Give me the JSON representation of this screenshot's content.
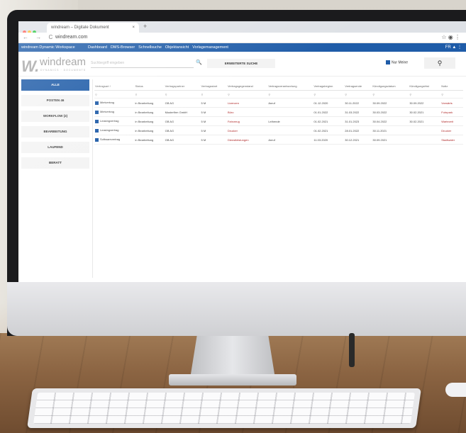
{
  "browser": {
    "tab_title": "windream – Digitale Dokument",
    "tab_close": "×",
    "new_tab": "+",
    "nav": "← → C",
    "url": "windream.com",
    "right_icons": "☆ ◉ ⋮",
    "dot_colors": [
      "#ff5f57",
      "#febc2e",
      "#28c840"
    ]
  },
  "appbar": {
    "brand": "windream Dynamic Workspace",
    "links": [
      "Dashboard",
      "DMS-Browser",
      "Schnellsuche",
      "Objekt­ansicht",
      "Vorlagemanagement"
    ],
    "right": "FR ▲ ⋮"
  },
  "toolbar": {
    "logo_mark": "W.",
    "logo_text": "windream",
    "logo_sub": "DYNAMICS · DOCUMENTS",
    "search_placeholder": "Suchbegriff eingeben",
    "search_icon": "🔍",
    "advanced_search": "ERWEITERTE SUCHE",
    "checkbox_label": "Nur Meine",
    "filter_icon": "⚲"
  },
  "sidebar": {
    "items": [
      {
        "label": "ALLE",
        "active": true
      },
      {
        "label": "POSTEN 46",
        "active": false
      },
      {
        "label": "WORKFLOW (2)",
        "active": false
      },
      {
        "label": "BEARBEITUNG",
        "active": false
      },
      {
        "label": "LAUFEND",
        "active": false
      },
      {
        "label": "BERATT",
        "active": false
      }
    ]
  },
  "table": {
    "columns": [
      "Vertragsart ↑",
      "Status",
      "Vertragspartner",
      "Vertragsstart",
      "Vertragsgegenstand",
      "Vertragsverantwortung",
      "Vertragsbeginn",
      "Vertragsende",
      "Kündigungsdatum",
      "Kündigungsfrist",
      "Notiz"
    ],
    "rows": [
      [
        "Mietvertrag",
        "in Bearbeitung",
        "GB AG",
        "5 M",
        "Lizenzen",
        "Anruf",
        "01.12.2020",
        "30.11.2022",
        "30.09.2022",
        "30.09.2022",
        "Vorwärts"
      ],
      [
        "Mietvertrag",
        "in Bearbeitung",
        "Musterfirm GmbH",
        "5 M",
        "Büro",
        "",
        "01.01.2022",
        "31.03.2022",
        "30.03.2022",
        "30.02.2021",
        "Fuhrpark"
      ],
      [
        "Leasingvertrag",
        "in Bearbeitung",
        "GB AG",
        "5 M",
        "Fahrzeug",
        "Leihende",
        "01.02.2021",
        "31.01.2023",
        "30.04.2022",
        "30.02.2021",
        "Wartezeit"
      ],
      [
        "Leasingvertrag",
        "in Bearbeitung",
        "GB AG",
        "5 M",
        "Drucker",
        "",
        "01.02.2021",
        "28.01.2022",
        "30.11.2021",
        "",
        "Drucker"
      ],
      [
        "Softwarevertrag",
        "in Bearbeitung",
        "GB AG",
        "5 M",
        "Dienstleistungen",
        "Anruf",
        "11.03.2020",
        "30.12.2021",
        "30.09.2021",
        "",
        "Stadtwaler"
      ]
    ]
  }
}
